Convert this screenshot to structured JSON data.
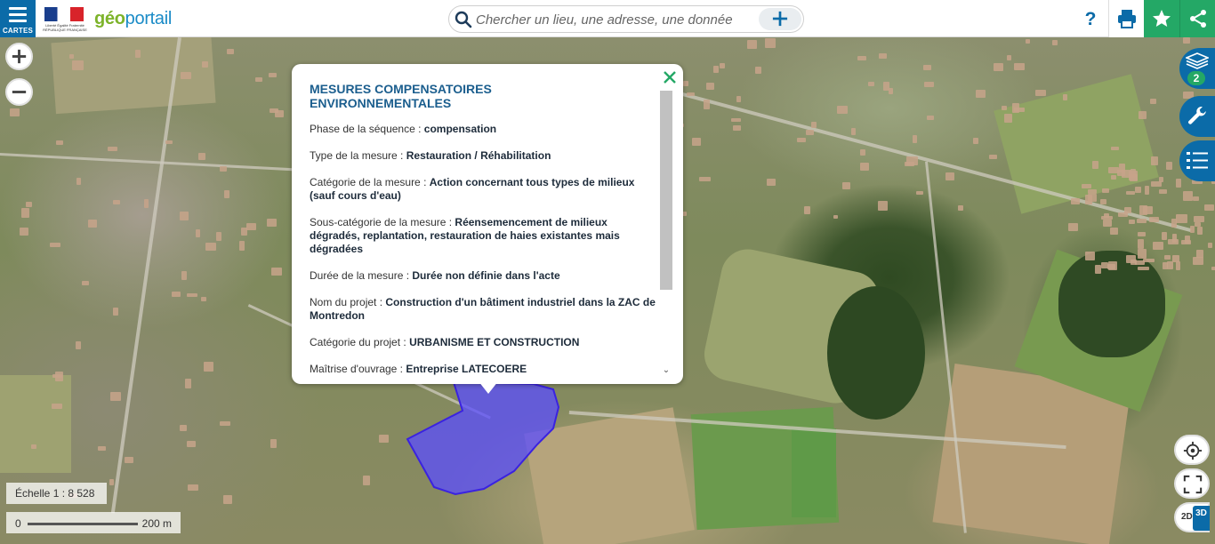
{
  "topbar": {
    "cartes_label": "CARTES",
    "republic_text": "Liberté Égalité Fraternité RÉPUBLIQUE FRANÇAISE",
    "logo_part1": "géo",
    "logo_part2": "portail",
    "search_placeholder": "Chercher un lieu, une adresse, une donnée",
    "help_label": "?"
  },
  "map_controls": {
    "zoom_in": "+",
    "zoom_out": "−",
    "layer_count": "2",
    "mode_2d": "2D",
    "mode_3d": "3D"
  },
  "scale": {
    "ratio_text": "Échelle 1 : 8 528",
    "bar_start": "0",
    "bar_end": "200 m"
  },
  "popup": {
    "title": "MESURES COMPENSATOIRES ENVIRONNEMENTALES",
    "fields": [
      {
        "label": "Phase de la séquence : ",
        "value": "compensation"
      },
      {
        "label": "Type de la mesure : ",
        "value": "Restauration / Réhabilitation"
      },
      {
        "label": "Catégorie de la mesure : ",
        "value": "Action concernant tous types de milieux (sauf cours d'eau)"
      },
      {
        "label": "Sous-catégorie de la mesure : ",
        "value": "Réensemencement de milieux dégradés, replantation, restauration de haies existantes mais dégradées"
      },
      {
        "label": "Durée de la mesure : ",
        "value": "Durée non définie dans l'acte"
      },
      {
        "label": "Nom du projet : ",
        "value": "Construction d'un bâtiment industriel dans la ZAC de Montredon"
      },
      {
        "label": "Catégorie du projet : ",
        "value": "URBANISME ET CONSTRUCTION"
      },
      {
        "label": "Maîtrise d'ouvrage : ",
        "value": "Entreprise LATECOERE"
      }
    ]
  },
  "colors": {
    "brand_blue": "#0b6ba8",
    "brand_green": "#24a866",
    "polygon_fill": "#5a4cff",
    "polygon_stroke": "#3a22e0"
  }
}
